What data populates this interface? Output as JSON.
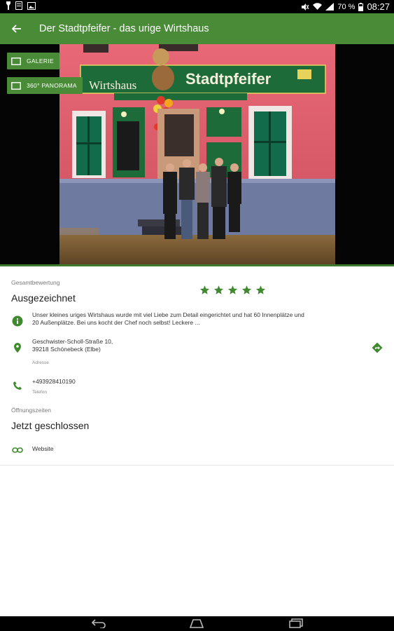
{
  "status_bar": {
    "battery_percent": "70 %",
    "time": "08:27"
  },
  "toolbar": {
    "title": "Der Stadtpfeifer - das urige Wirtshaus"
  },
  "hero": {
    "galerie_label": "GALERIE",
    "panorama_label": "360° PANORAMA",
    "photo_sign_text": "Stadtpfeifer",
    "photo_sign_script": "Wirtshaus"
  },
  "rating": {
    "label": "Gesamtbewertung",
    "value_text": "Ausgezeichnet",
    "stars": 5,
    "color": "#3f8a2e"
  },
  "description": {
    "line1": "Unser kleines uriges Wirtshaus wurde mit viel Liebe zum Detail eingerichtet und hat 60 Innenplätze und",
    "line2": "20 Außenplätze. Bei uns kocht der Chef noch selbst! Leckere ..."
  },
  "address": {
    "line1": "Geschwister-Scholl-Straße 10,",
    "line2": "39218 Schönebeck (Elbe)",
    "caption": "Adresse"
  },
  "phone": {
    "number": "+493928410190",
    "caption": "Telefon"
  },
  "hours": {
    "label": "Öffnungszeiten",
    "status": "Jetzt geschlossen"
  },
  "website": {
    "label": "Website"
  },
  "colors": {
    "brand_green": "#4a8b38",
    "icon_green": "#3f8a2e"
  }
}
